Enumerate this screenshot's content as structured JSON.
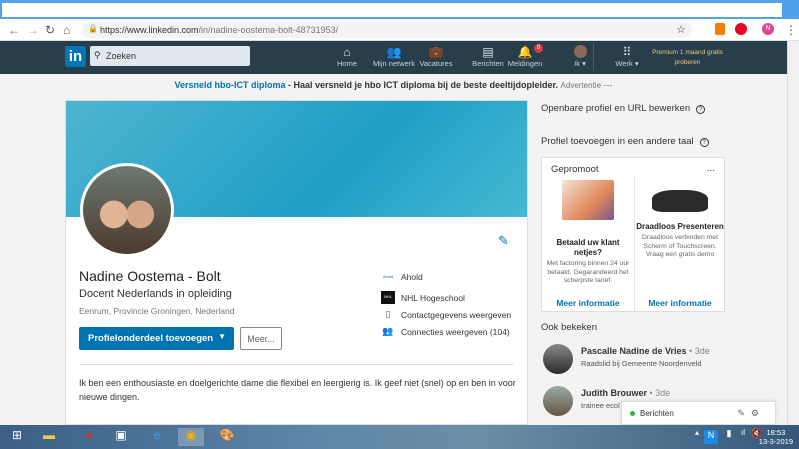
{
  "browser": {
    "url_host": "https://www.linkedin.com",
    "url_path": "/in/nadine-oostema-bolt-48731953/",
    "profile_initial": "N"
  },
  "nav": {
    "logo": "in",
    "search_placeholder": "Zoeken",
    "items": [
      {
        "label": "Home",
        "icon": "home-icon"
      },
      {
        "label": "Mijn netwerk",
        "icon": "network-icon"
      },
      {
        "label": "Vacatures",
        "icon": "briefcase-icon"
      },
      {
        "label": "Berichten",
        "icon": "messages-icon"
      },
      {
        "label": "Meldingen",
        "icon": "bell-icon"
      },
      {
        "label": "Ik ▾",
        "icon": "avatar"
      },
      {
        "label": "Werk ▾",
        "icon": "grid-icon"
      }
    ],
    "notifications": "8",
    "premium": "Premium 1 maand gratis proberen"
  },
  "ad": {
    "link": "Versneld hbo-ICT diploma",
    "text": " - Haal versneld je hbo ICT diploma bij de beste deeltijdopleider.",
    "tag": "Advertentie",
    "more": "···"
  },
  "profile": {
    "name": "Nadine Oostema - Bolt",
    "headline": "Docent Nederlands in opleiding",
    "location": "Eenrum, Provincie Groningen, Nederland",
    "add_button": "Profielonderdeel toevoegen",
    "more_button": "Meer...",
    "company": "Ahold",
    "company_logo": "Ahold",
    "school": "NHL Hogeschool",
    "school_logo": "NHL",
    "contact": "Contactgegevens weergeven",
    "connections": "Connecties weergeven (104)",
    "about": "Ik ben een enthousiaste en doelgerichte dame die flexibel en leergierig is. Ik geef niet (snel) op en ben in voor nieuwe dingen."
  },
  "right": {
    "public_profile": "Openbare profiel en URL bewerken",
    "add_language": "Profiel toevoegen in een andere taal",
    "promo_title": "Gepromoot",
    "promo_more": "...",
    "promos": [
      {
        "title": "Betaald uw klant netjes?",
        "desc": "Met factoring binnen 24 uur betaald. Gegarandeerd het scherpste tarief.",
        "link": "Meer informatie"
      },
      {
        "title": "Draadloos Presenteren",
        "desc": "Draadloos verbinden met Scherm of Touchscreen. Vraag een gratis demo",
        "link": "Meer informatie"
      }
    ],
    "also_viewed": "Ook bekeken",
    "people": [
      {
        "name": "Pascalle Nadine de Vries",
        "degree": " • 3de",
        "job": "Raadslid bij Gemeente Noordenveld"
      },
      {
        "name": "Judith Brouwer",
        "degree": " • 3de",
        "job": "trainee ecol"
      }
    ]
  },
  "messaging": {
    "label": "Berichten"
  },
  "taskbar": {
    "time": "18:53",
    "date": "13-3-2019"
  }
}
